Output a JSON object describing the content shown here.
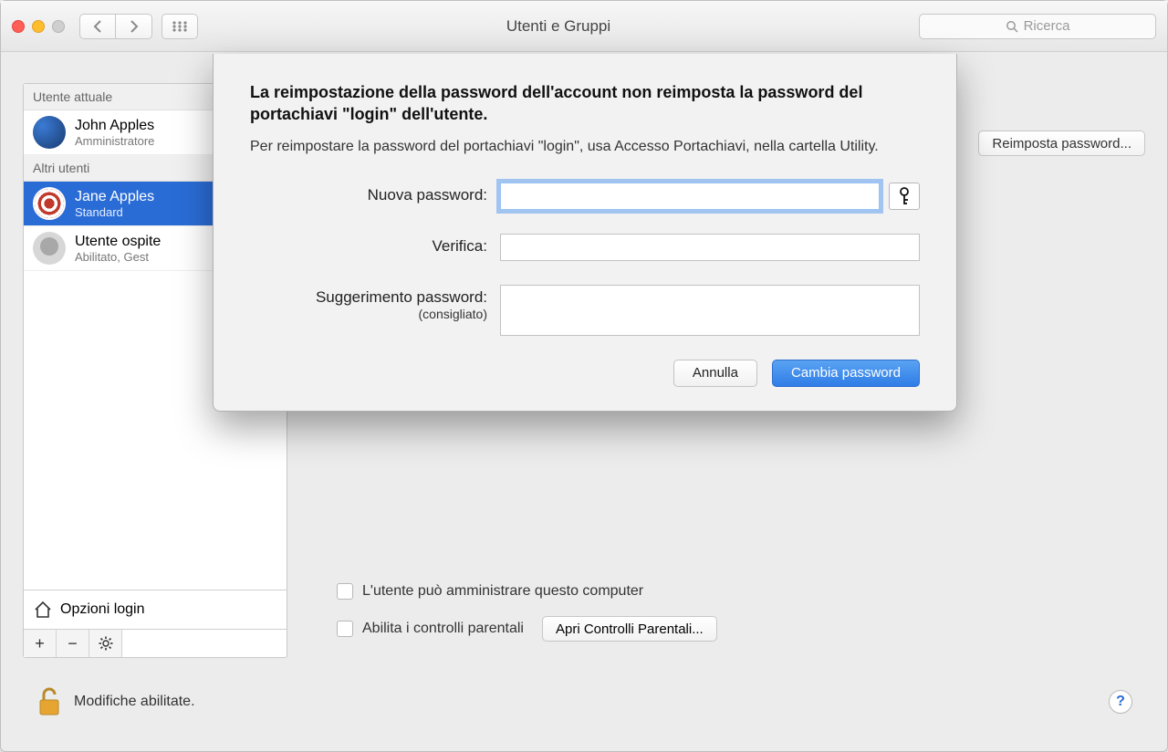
{
  "window": {
    "title": "Utenti e Gruppi",
    "search_placeholder": "Ricerca"
  },
  "sidebar": {
    "current_user_header": "Utente attuale",
    "current_user": {
      "name": "John Apples",
      "role": "Amministratore"
    },
    "other_users_header": "Altri utenti",
    "users": [
      {
        "name": "Jane Apples",
        "role": "Standard",
        "selected": true
      },
      {
        "name": "Utente ospite",
        "role": "Abilitato, Gest"
      }
    ],
    "login_options": "Opzioni login"
  },
  "main": {
    "reset_password_button": "Reimposta password...",
    "admin_checkbox": "L'utente può amministrare questo computer",
    "parental_checkbox": "Abilita i controlli parentali",
    "open_parental_button": "Apri Controlli Parentali..."
  },
  "footer": {
    "lock_text": "Modifiche abilitate."
  },
  "sheet": {
    "heading": "La reimpostazione della password dell'account non reimposta la password del portachiavi \"login\" dell'utente.",
    "description": "Per reimpostare la password del portachiavi \"login\", usa Accesso Portachiavi, nella cartella Utility.",
    "labels": {
      "new_password": "Nuova password:",
      "verify": "Verifica:",
      "hint_label": "Suggerimento password:",
      "hint_sub": "(consigliato)"
    },
    "values": {
      "new_password": "",
      "verify": "",
      "hint": ""
    },
    "buttons": {
      "cancel": "Annulla",
      "confirm": "Cambia password"
    }
  }
}
